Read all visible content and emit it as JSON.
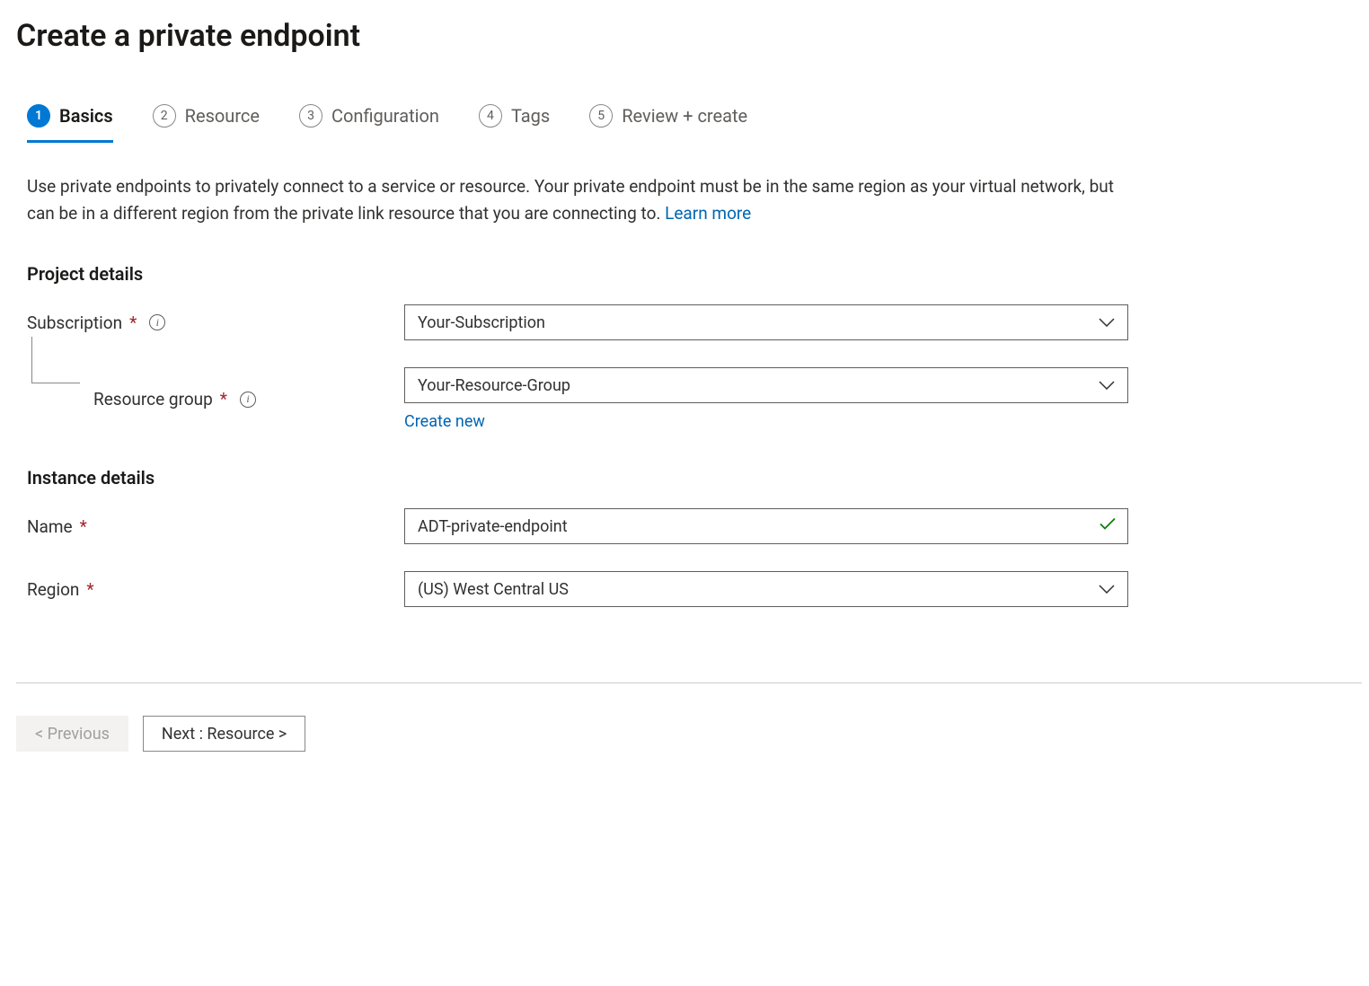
{
  "page": {
    "title": "Create a private endpoint"
  },
  "tabs": [
    {
      "num": "1",
      "label": "Basics"
    },
    {
      "num": "2",
      "label": "Resource"
    },
    {
      "num": "3",
      "label": "Configuration"
    },
    {
      "num": "4",
      "label": "Tags"
    },
    {
      "num": "5",
      "label": "Review + create"
    }
  ],
  "description": {
    "text": "Use private endpoints to privately connect to a service or resource. Your private endpoint must be in the same region as your virtual network, but can be in a different region from the private link resource that you are connecting to.  ",
    "learn_more": "Learn more"
  },
  "sections": {
    "project_details": {
      "heading": "Project details",
      "subscription_label": "Subscription",
      "subscription_value": "Your-Subscription",
      "resource_group_label": "Resource group",
      "resource_group_value": "Your-Resource-Group",
      "create_new": "Create new"
    },
    "instance_details": {
      "heading": "Instance details",
      "name_label": "Name",
      "name_value": "ADT-private-endpoint",
      "region_label": "Region",
      "region_value": "(US) West Central US"
    }
  },
  "footer": {
    "previous": "< Previous",
    "next": "Next : Resource >"
  }
}
